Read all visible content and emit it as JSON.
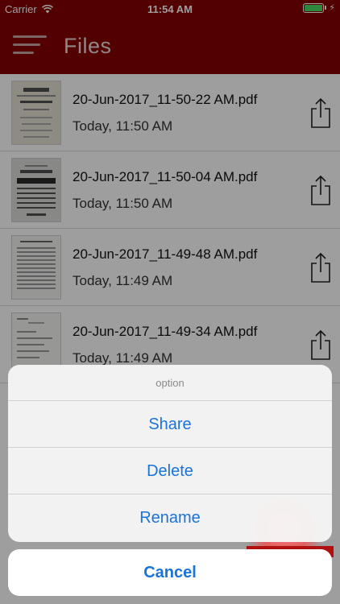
{
  "status_bar": {
    "carrier": "Carrier",
    "time": "11:54 AM",
    "battery_color": "#4cd964"
  },
  "nav": {
    "title": "Files",
    "menu_icon": "hamburger-menu-icon",
    "bar_color": "#850000"
  },
  "files": [
    {
      "name": "20-Jun-2017_11-50-22 AM.pdf",
      "date": "Today, 11:50 AM"
    },
    {
      "name": "20-Jun-2017_11-50-04 AM.pdf",
      "date": "Today, 11:50 AM"
    },
    {
      "name": "20-Jun-2017_11-49-48 AM.pdf",
      "date": "Today, 11:49 AM"
    },
    {
      "name": "20-Jun-2017_11-49-34 AM.pdf",
      "date": "Today, 11:49 AM"
    }
  ],
  "action_sheet": {
    "title": "option",
    "share_label": "Share",
    "delete_label": "Delete",
    "rename_label": "Rename",
    "cancel_label": "Cancel",
    "accent_color": "#1a73d9"
  }
}
